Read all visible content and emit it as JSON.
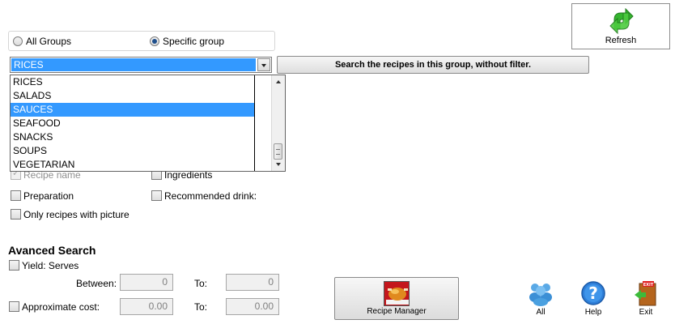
{
  "refresh": {
    "label": "Refresh"
  },
  "group_scope": {
    "all_label": "All Groups",
    "specific_label": "Specific group",
    "selected": "specific"
  },
  "group_select": {
    "value": "RICES"
  },
  "search_group_button": {
    "label": "Search the recipes in this group, without filter."
  },
  "dropdown": {
    "items": [
      {
        "label": "RICES"
      },
      {
        "label": "SALADS"
      },
      {
        "label": "SAUCES",
        "selected": true
      },
      {
        "label": "SEAFOOD"
      },
      {
        "label": "SNACKS"
      },
      {
        "label": "SOUPS"
      },
      {
        "label": "VEGETARIAN"
      }
    ]
  },
  "filters": {
    "recipe_name": "Recipe name",
    "ingredients": "Ingredients",
    "preparation": "Preparation",
    "recommended_drink": "Recommended drink:",
    "only_picture": "Only recipes with picture"
  },
  "advanced": {
    "heading": "Avanced Search",
    "yield_label": "Yield: Serves",
    "between_label": "Between:",
    "to_label": "To:",
    "yield_from": "0",
    "yield_to": "0",
    "cost_label": "Approximate cost:",
    "cost_from": "0.00",
    "cost_to": "0.00"
  },
  "toolbar": {
    "recipe_manager": "Recipe Manager",
    "all": "All",
    "help": "Help",
    "exit": "Exit",
    "exit_sign": "EXIT"
  }
}
